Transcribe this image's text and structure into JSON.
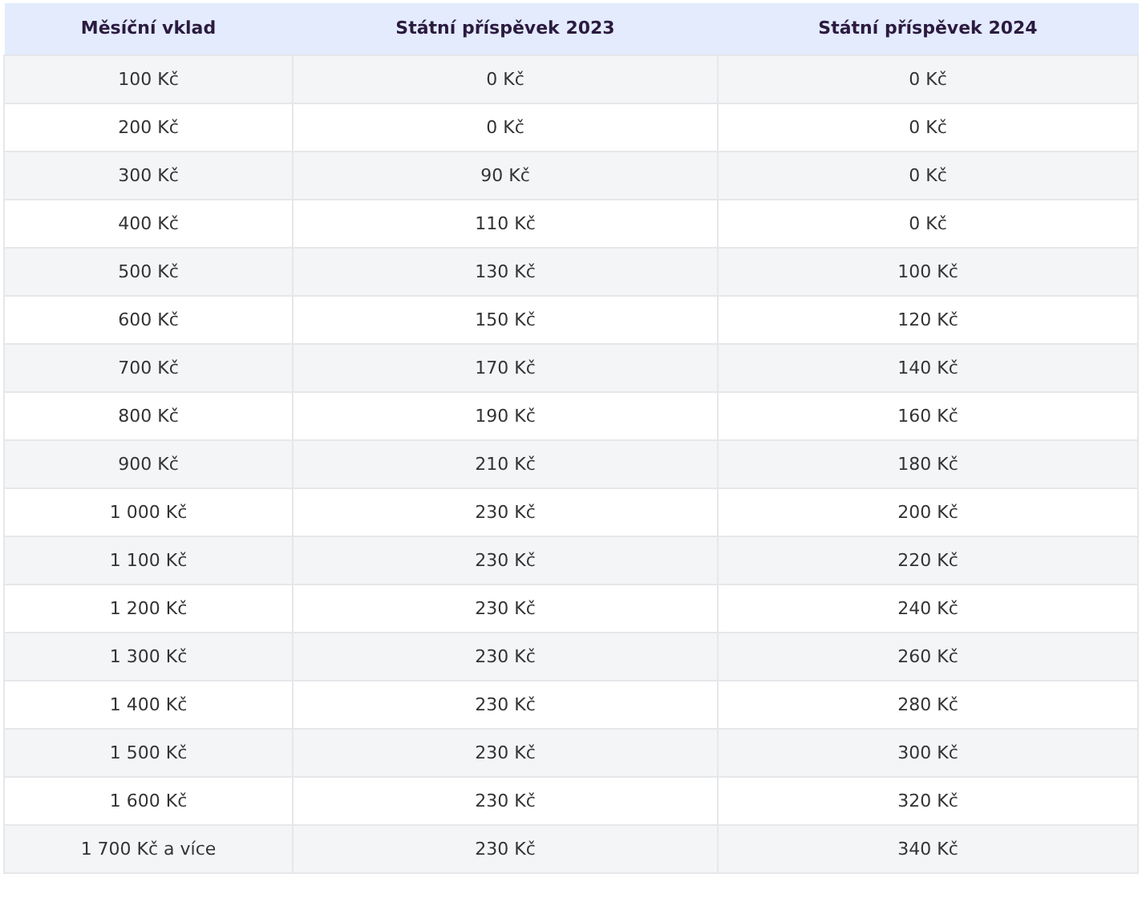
{
  "table": {
    "columns": [
      "Měsíční vklad",
      "Státní příspěvek 2023",
      "Státní příspěvek 2024"
    ],
    "rows": [
      [
        "100 Kč",
        "0 Kč",
        "0 Kč"
      ],
      [
        "200 Kč",
        "0 Kč",
        "0 Kč"
      ],
      [
        "300 Kč",
        "90 Kč",
        "0 Kč"
      ],
      [
        "400 Kč",
        "110 Kč",
        "0 Kč"
      ],
      [
        "500 Kč",
        "130 Kč",
        "100 Kč"
      ],
      [
        "600 Kč",
        "150 Kč",
        "120 Kč"
      ],
      [
        "700 Kč",
        "170 Kč",
        "140 Kč"
      ],
      [
        "800 Kč",
        "190 Kč",
        "160 Kč"
      ],
      [
        "900 Kč",
        "210 Kč",
        "180 Kč"
      ],
      [
        "1 000 Kč",
        "230 Kč",
        "200 Kč"
      ],
      [
        "1 100 Kč",
        "230 Kč",
        "220 Kč"
      ],
      [
        "1 200 Kč",
        "230 Kč",
        "240 Kč"
      ],
      [
        "1 300 Kč",
        "230 Kč",
        "260 Kč"
      ],
      [
        "1 400 Kč",
        "230 Kč",
        "280 Kč"
      ],
      [
        "1 500 Kč",
        "230 Kč",
        "300 Kč"
      ],
      [
        "1 600 Kč",
        "230 Kč",
        "320 Kč"
      ],
      [
        "1 700 Kč a více",
        "230 Kč",
        "340 Kč"
      ]
    ]
  }
}
